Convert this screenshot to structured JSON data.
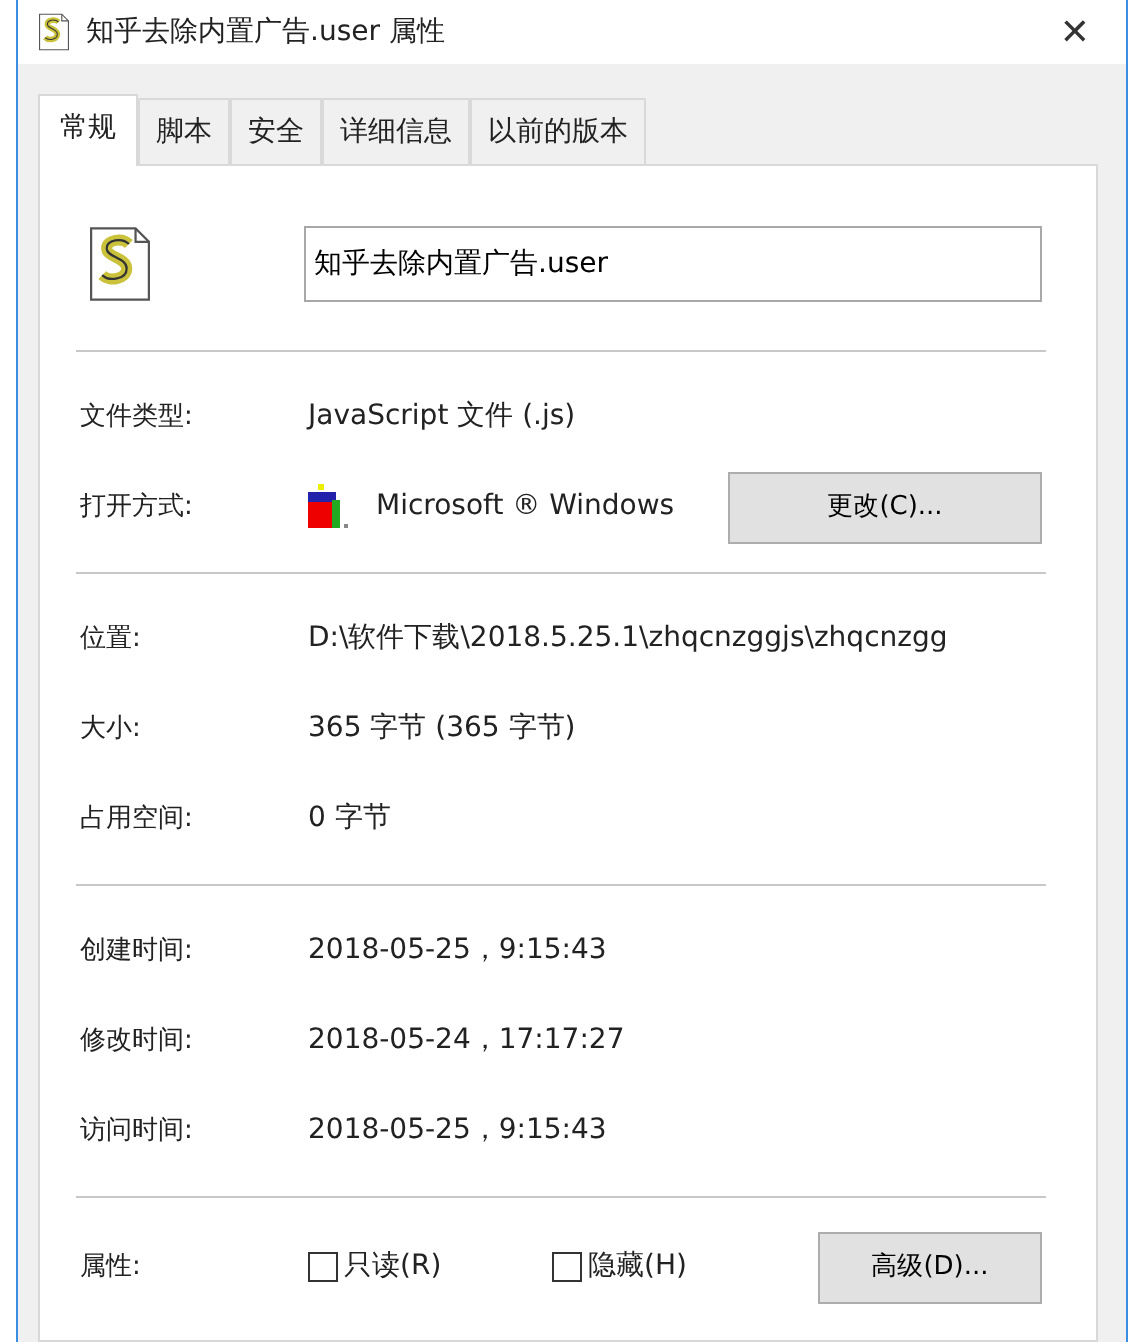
{
  "window": {
    "title": "知乎去除内置广告.user 属性",
    "close": "✕"
  },
  "tabs": [
    {
      "label": "常规",
      "selected": true
    },
    {
      "label": "脚本",
      "selected": false
    },
    {
      "label": "安全",
      "selected": false
    },
    {
      "label": "详细信息",
      "selected": false
    },
    {
      "label": "以前的版本",
      "selected": false
    }
  ],
  "file_name": "知乎去除内置广告.user",
  "sections": [
    [
      {
        "label": "文件类型:",
        "value": "JavaScript 文件 (.js)"
      },
      {
        "label": "打开方式:",
        "value": "Microsoft ® Windows",
        "kind": "app",
        "button": "更改(C)..."
      }
    ],
    [
      {
        "label": "位置:",
        "value": "D:\\软件下载\\2018.5.25.1\\zhqcnzggjs\\zhqcnzgg"
      },
      {
        "label": "大小:",
        "value": "365 字节 (365 字节)"
      },
      {
        "label": "占用空间:",
        "value": "0 字节"
      }
    ],
    [
      {
        "label": "创建时间:",
        "value": "2018-05-25，9:15:43"
      },
      {
        "label": "修改时间:",
        "value": "2018-05-24，17:17:27"
      },
      {
        "label": "访问时间:",
        "value": "2018-05-25，9:15:43"
      }
    ]
  ],
  "attributes": {
    "label": "属性:",
    "checkboxes": [
      {
        "label": "只读(R)",
        "checked": false
      },
      {
        "label": "隐藏(H)",
        "checked": false
      }
    ],
    "button": "高级(D)..."
  }
}
